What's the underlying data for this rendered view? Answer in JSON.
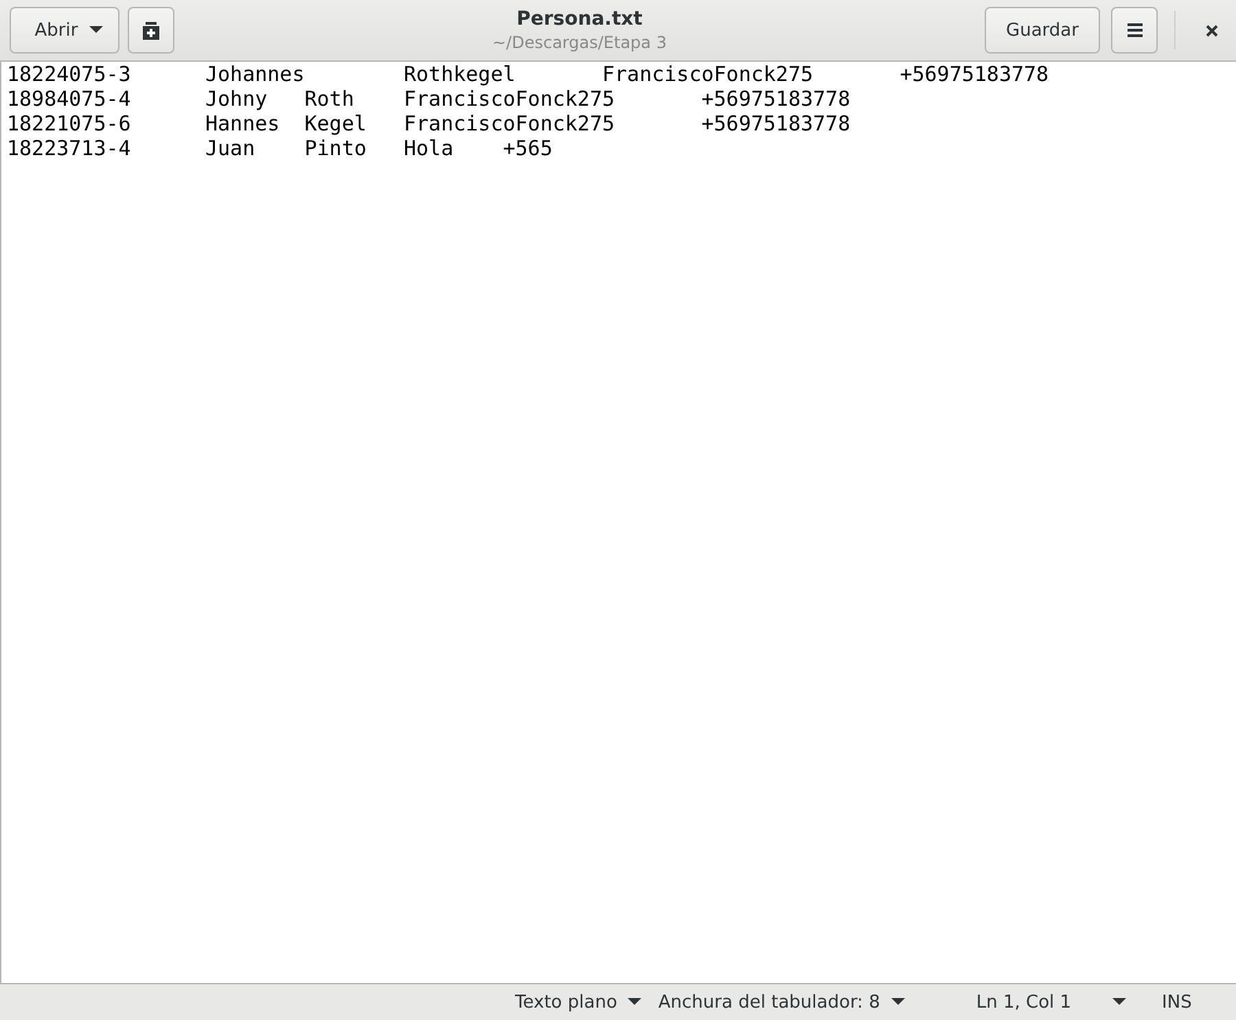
{
  "header": {
    "open_button": "Abrir",
    "title": "Persona.txt",
    "subtitle": "~/Descargas/Etapa 3",
    "save_button": "Guardar"
  },
  "lines": [
    "18224075-3\tJohannes\tRothkegel\tFranciscoFonck275\t+56975183778",
    "18984075-4\tJohny\tRoth\tFranciscoFonck275\t+56975183778",
    "18221075-6\tHannes\tKegel\tFranciscoFonck275\t+56975183778",
    "18223713-4\tJuan\tPinto\tHola\t+565"
  ],
  "status_bar": {
    "language": "Texto plano",
    "tab_width": "Anchura del tabulador: 8",
    "position": "Ln 1, Col 1",
    "mode": "INS"
  }
}
